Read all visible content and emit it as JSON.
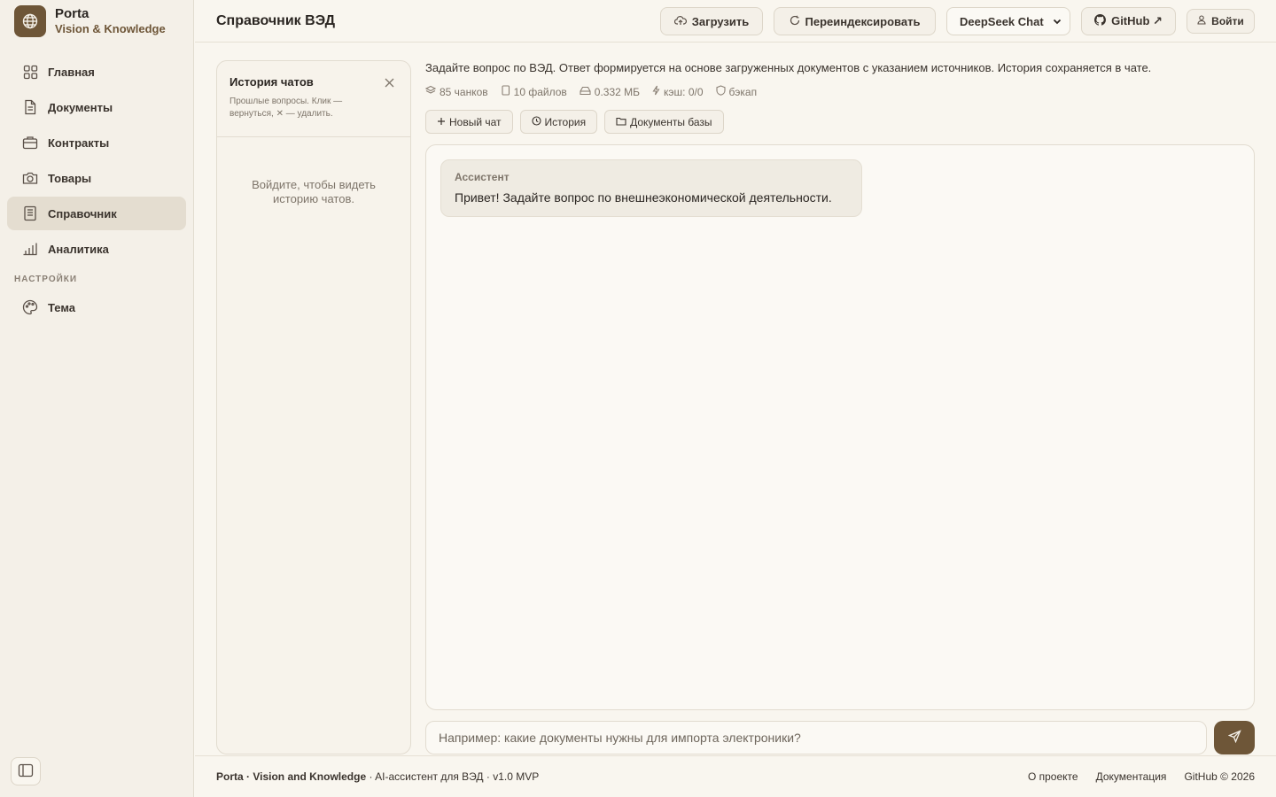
{
  "brand": {
    "name": "Porta",
    "subtitle": "Vision & Knowledge"
  },
  "sidebar": {
    "items": [
      {
        "label": "Главная",
        "icon": "grid-icon"
      },
      {
        "label": "Документы",
        "icon": "document-icon"
      },
      {
        "label": "Контракты",
        "icon": "briefcase-icon"
      },
      {
        "label": "Товары",
        "icon": "camera-icon"
      },
      {
        "label": "Справочник",
        "icon": "book-icon",
        "active": true
      },
      {
        "label": "Аналитика",
        "icon": "bar-chart-icon"
      }
    ],
    "section_settings": "НАСТРОЙКИ",
    "settings_items": [
      {
        "label": "Тема",
        "icon": "palette-icon"
      }
    ]
  },
  "header": {
    "title": "Справочник ВЭД",
    "upload_label": "Загрузить",
    "reindex_label": "Переиндексировать",
    "model_selected": "DeepSeek Chat",
    "github_label": "GitHub ↗",
    "login_label": "Войти"
  },
  "history": {
    "title": "История чатов",
    "description": "Прошлые вопросы. Клик — вернуться, ✕ — удалить.",
    "empty": "Войдите, чтобы видеть историю чатов."
  },
  "main": {
    "intro": "Задайте вопрос по ВЭД. Ответ формируется на основе загруженных документов с указанием источников. История сохраняется в чате.",
    "stats": {
      "chunks": "85 чанков",
      "files": "10 файлов",
      "size": "0.332 МБ",
      "cache": "кэш: 0/0",
      "backup": "бэкап"
    },
    "actions": {
      "new_chat": "Новый чат",
      "history": "История",
      "docs": "Документы базы"
    }
  },
  "chat": {
    "messages": [
      {
        "role": "Ассистент",
        "text": "Привет! Задайте вопрос по внешнеэкономической деятельности."
      }
    ],
    "input_placeholder": "Например: какие документы нужны для импорта электроники?"
  },
  "footer": {
    "brand": "Porta · Vision and Knowledge",
    "tagline": " · AI-ассистент для ВЭД · v1.0 MVP",
    "links": {
      "about": "О проекте",
      "docs": "Документация",
      "github": "GitHub © 2026"
    }
  },
  "colors": {
    "accent": "#6e5638",
    "background": "#f9f6ef",
    "sidebar": "#f4f0e8"
  }
}
